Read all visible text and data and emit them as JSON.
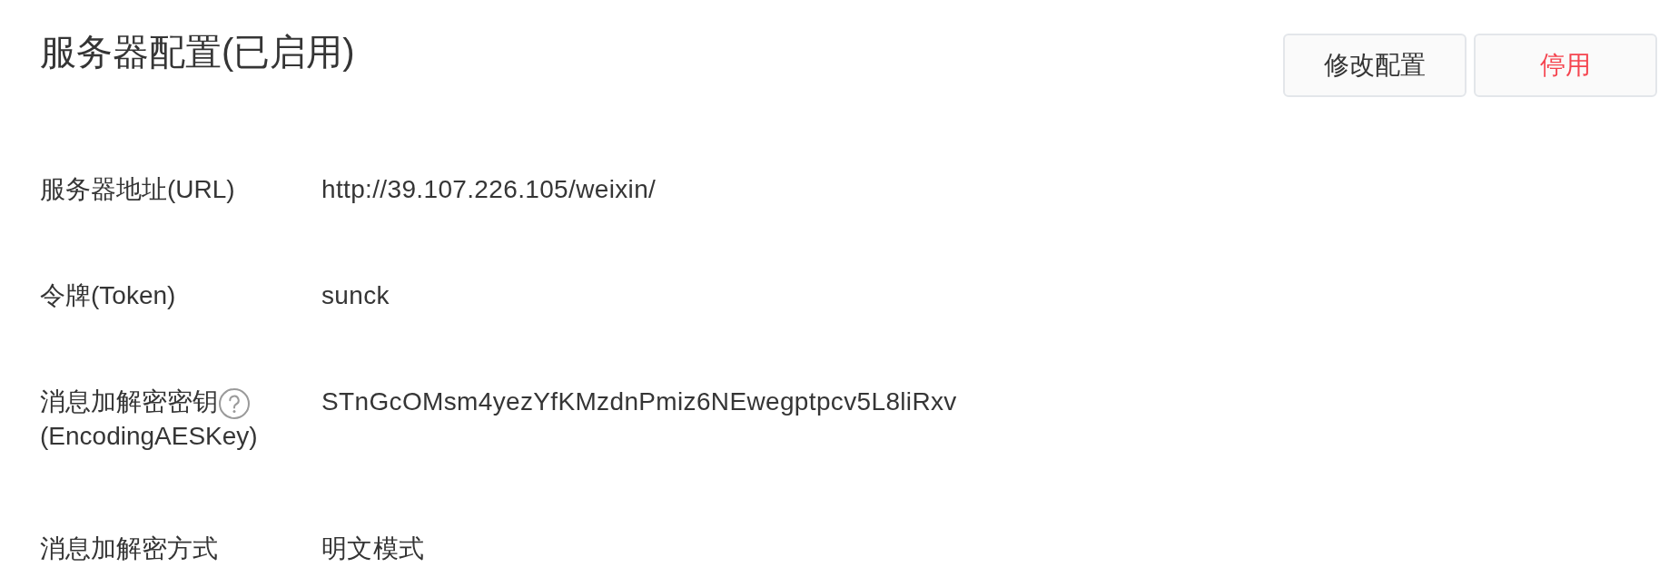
{
  "title": "服务器配置(已启用)",
  "buttons": [
    {
      "label": "修改配置",
      "kind": "default"
    },
    {
      "label": "停用",
      "kind": "danger"
    }
  ],
  "fields": [
    {
      "label": "服务器地址(URL)",
      "help_icon": false,
      "value": "http://39.107.226.105/weixin/"
    },
    {
      "label": "令牌(Token)",
      "help_icon": false,
      "value": "sunck"
    },
    {
      "label": "消息加解密密钥",
      "help_icon": true,
      "label_note": "(EncodingAESKey)",
      "value": "STnGcOMsm4yezYfKMzdnPmiz6NEwegptpcv5L8liRxv"
    },
    {
      "label": "消息加解密方式",
      "help_icon": false,
      "value": "明文模式"
    }
  ]
}
